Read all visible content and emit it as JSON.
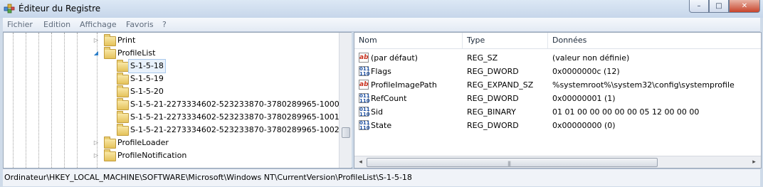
{
  "window": {
    "title": "Éditeur du Registre",
    "icon": "registry-editor-icon",
    "controls": [
      "minimize-icon",
      "maximize-icon",
      "close-icon"
    ],
    "minimize_glyph": "–",
    "maximize_glyph": "□",
    "close_glyph": "✕"
  },
  "menu": {
    "items": [
      "Fichier",
      "Edition",
      "Affichage",
      "Favoris",
      "?"
    ]
  },
  "tree": {
    "nodes": [
      {
        "label": "Print",
        "expander": "▷"
      },
      {
        "label": "ProfileList",
        "expander": "◢"
      },
      {
        "label": "S-1-5-18",
        "selected": true
      },
      {
        "label": "S-1-5-19"
      },
      {
        "label": "S-1-5-20"
      },
      {
        "label": "S-1-5-21-2273334602-523233870-3780289965-1000"
      },
      {
        "label": "S-1-5-21-2273334602-523233870-3780289965-1001"
      },
      {
        "label": "S-1-5-21-2273334602-523233870-3780289965-1002"
      },
      {
        "label": "ProfileLoader",
        "expander": "▷"
      },
      {
        "label": "ProfileNotification",
        "expander": "▷"
      }
    ]
  },
  "values": {
    "columns": [
      "Nom",
      "Type",
      "Données"
    ],
    "rows": [
      {
        "icon": "string-value-icon",
        "icon_text": "ab",
        "name": "(par défaut)",
        "type": "REG_SZ",
        "data": "(valeur non définie)"
      },
      {
        "icon": "binary-value-icon",
        "icon_text": "011 110",
        "name": "Flags",
        "type": "REG_DWORD",
        "data": "0x0000000c (12)"
      },
      {
        "icon": "string-value-icon",
        "icon_text": "ab",
        "name": "ProfileImagePath",
        "type": "REG_EXPAND_SZ",
        "data": "%systemroot%\\system32\\config\\systemprofile"
      },
      {
        "icon": "binary-value-icon",
        "icon_text": "011 110",
        "name": "RefCount",
        "type": "REG_DWORD",
        "data": "0x00000001 (1)"
      },
      {
        "icon": "binary-value-icon",
        "icon_text": "011 110",
        "name": "Sid",
        "type": "REG_BINARY",
        "data": "01 01 00 00 00 00 00 05 12 00 00 00"
      },
      {
        "icon": "binary-value-icon",
        "icon_text": "011 110",
        "name": "State",
        "type": "REG_DWORD",
        "data": "0x00000000 (0)"
      }
    ],
    "hscroll": {
      "left": "◂",
      "right": "▸",
      "grip": "|||"
    }
  },
  "status": {
    "path": "Ordinateur\\HKEY_LOCAL_MACHINE\\SOFTWARE\\Microsoft\\Windows NT\\CurrentVersion\\ProfileList\\S-1-5-18"
  },
  "colors": {
    "frame": "#cfdbe9",
    "selection": "#e8f1fb",
    "close_button": "#c8442b"
  }
}
